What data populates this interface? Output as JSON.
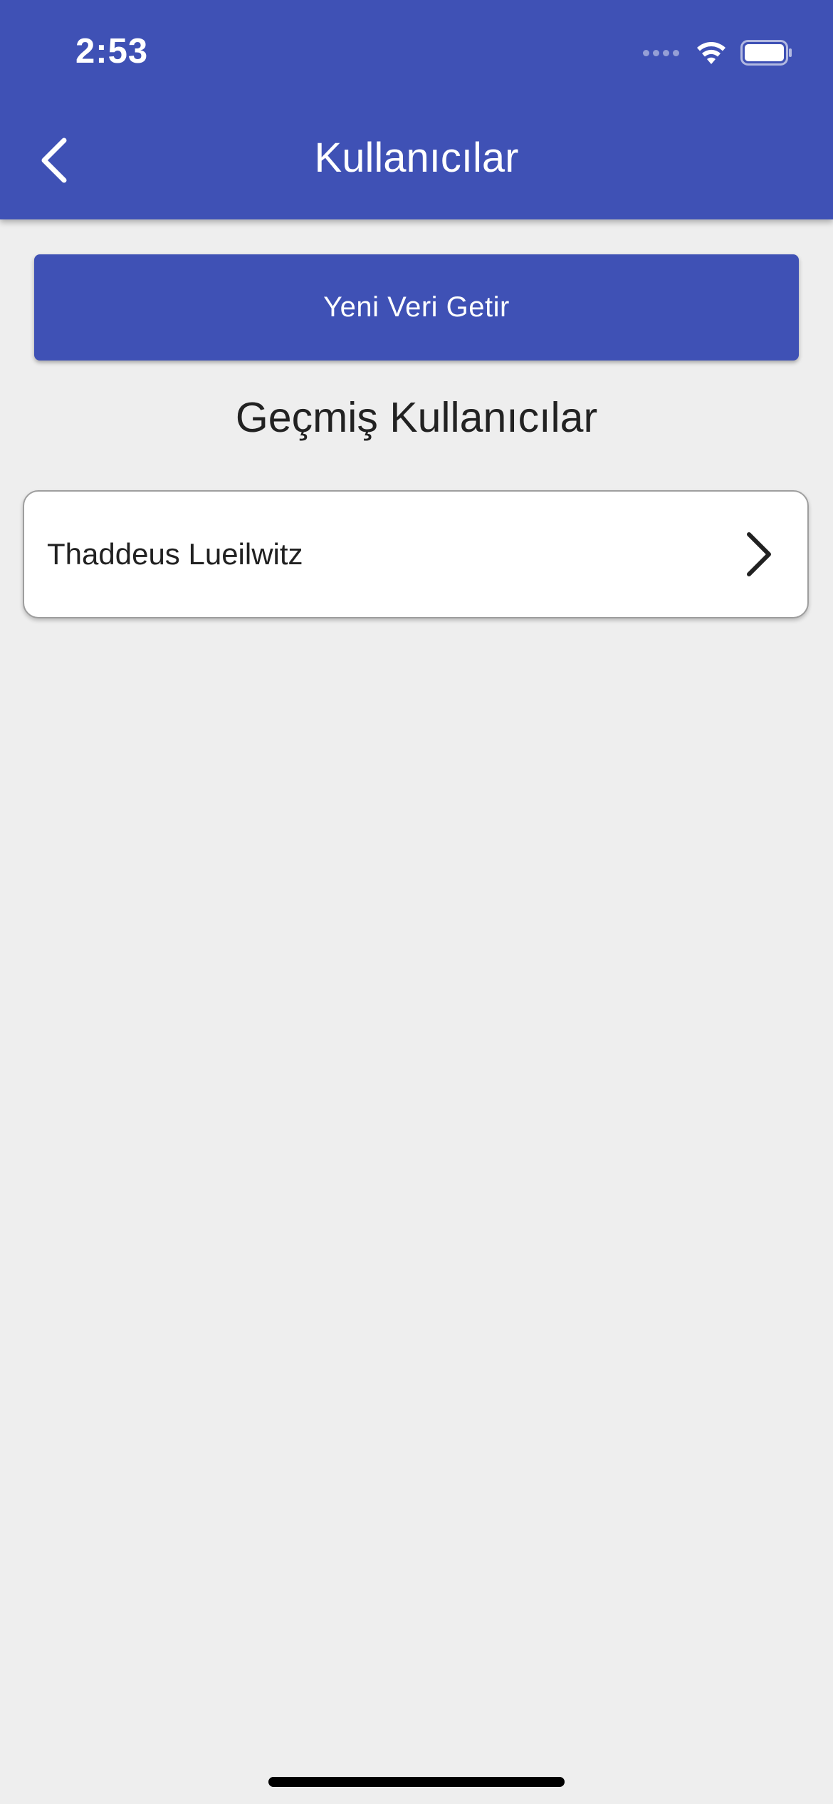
{
  "status_bar": {
    "time": "2:53",
    "icons": [
      "cellular-signal-icon",
      "wifi-icon",
      "battery-icon"
    ]
  },
  "app_bar": {
    "title": "Kullanıcılar",
    "back_icon": "chevron-left-icon",
    "color": "#3f51b5"
  },
  "actions": {
    "fetch_label": "Yeni Veri Getir"
  },
  "history": {
    "title": "Geçmiş Kullanıcılar",
    "users": [
      {
        "name": "Thaddeus Lueilwitz",
        "icon": "chevron-right-icon"
      }
    ]
  },
  "colors": {
    "background": "#eeeeee",
    "primary": "#3f51b5"
  }
}
